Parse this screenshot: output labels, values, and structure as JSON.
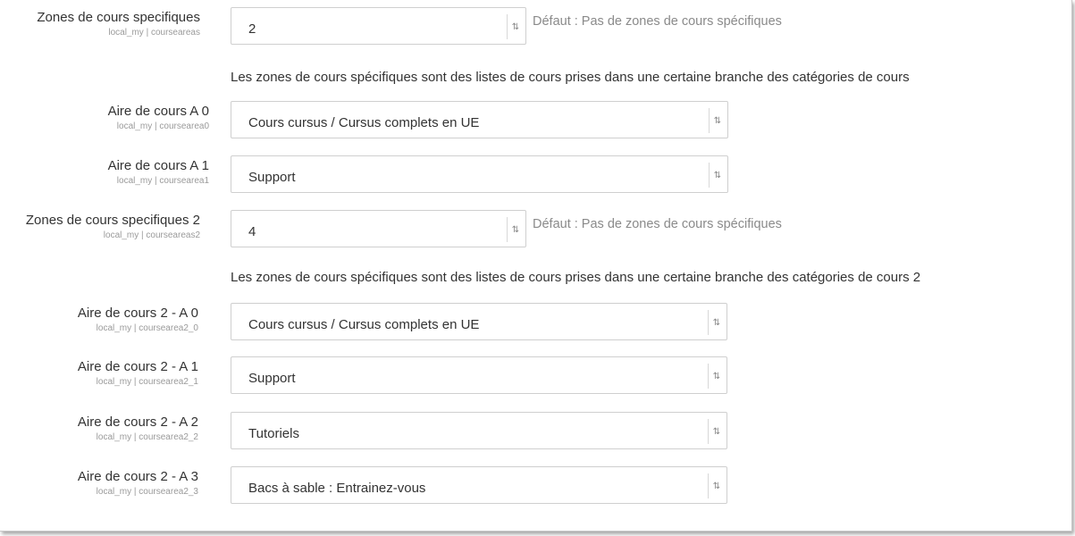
{
  "zones": {
    "label": "Zones de cours specifiques",
    "key": "local_my | courseareas",
    "value": "2",
    "hint": "Défaut : Pas de zones de cours spécifiques",
    "description": "Les zones de cours spécifiques sont des listes de cours prises dans une certaine branche des catégories de cours"
  },
  "areas": [
    {
      "label": "Aire de cours A 0",
      "key": "local_my | coursearea0",
      "value": "Cours cursus / Cursus complets en UE"
    },
    {
      "label": "Aire de cours A 1",
      "key": "local_my | coursearea1",
      "value": "Support"
    }
  ],
  "zones2": {
    "label": "Zones de cours specifiques 2",
    "key": "local_my | courseareas2",
    "value": "4",
    "hint": "Défaut : Pas de zones de cours spécifiques",
    "description": "Les zones de cours spécifiques sont des listes de cours prises dans une certaine branche des catégories de cours 2"
  },
  "areas2": [
    {
      "label": "Aire de cours 2 - A 0",
      "key": "local_my | coursearea2_0",
      "value": "Cours cursus / Cursus complets en UE"
    },
    {
      "label": "Aire de cours 2 - A 1",
      "key": "local_my | coursearea2_1",
      "value": "Support"
    },
    {
      "label": "Aire de cours 2 - A 2",
      "key": "local_my | coursearea2_2",
      "value": "Tutoriels"
    },
    {
      "label": "Aire de cours 2 - A 3",
      "key": "local_my | coursearea2_3",
      "value": "Bacs à sable : Entrainez-vous"
    }
  ],
  "icons": {
    "select_arrow": "chevron-down-icon"
  }
}
